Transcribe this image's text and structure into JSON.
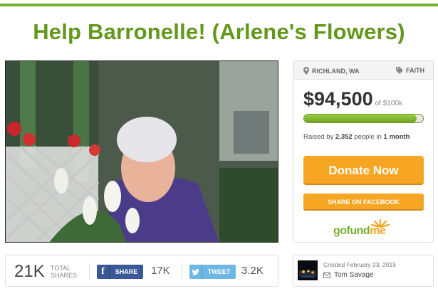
{
  "campaign": {
    "title": "Help Barronelle! (Arlene's Flowers)"
  },
  "meta": {
    "location": "RICHLAND, WA",
    "category": "FAITH"
  },
  "funding": {
    "amount": "$94,500",
    "goal_text": "of $100k",
    "progress_fraction": 0.945,
    "raised_prefix": "Raised by ",
    "people_count": "2,352",
    "people_mid": " people in ",
    "duration": "1 month"
  },
  "actions": {
    "donate_label": "Donate Now",
    "share_facebook_label": "SHARE ON FACEBOOK"
  },
  "logo": {
    "go": "gofund",
    "me": "me"
  },
  "shares": {
    "total": "21K",
    "total_label_1": "TOTAL",
    "total_label_2": "SHARES",
    "facebook_label": "SHARE",
    "facebook_count": "17K",
    "twitter_label": "TWEET",
    "twitter_count": "3.2K"
  },
  "creator": {
    "created_text": "Created February 23, 2015",
    "name": "Tom Savage"
  },
  "colors": {
    "brand_green": "#62981c",
    "accent_orange": "#f6a623",
    "facebook_blue": "#3b5998",
    "twitter_blue": "#6fb7e3"
  },
  "icons": [
    "location-pin-icon",
    "tag-icon",
    "facebook-icon",
    "twitter-icon",
    "mail-icon"
  ]
}
